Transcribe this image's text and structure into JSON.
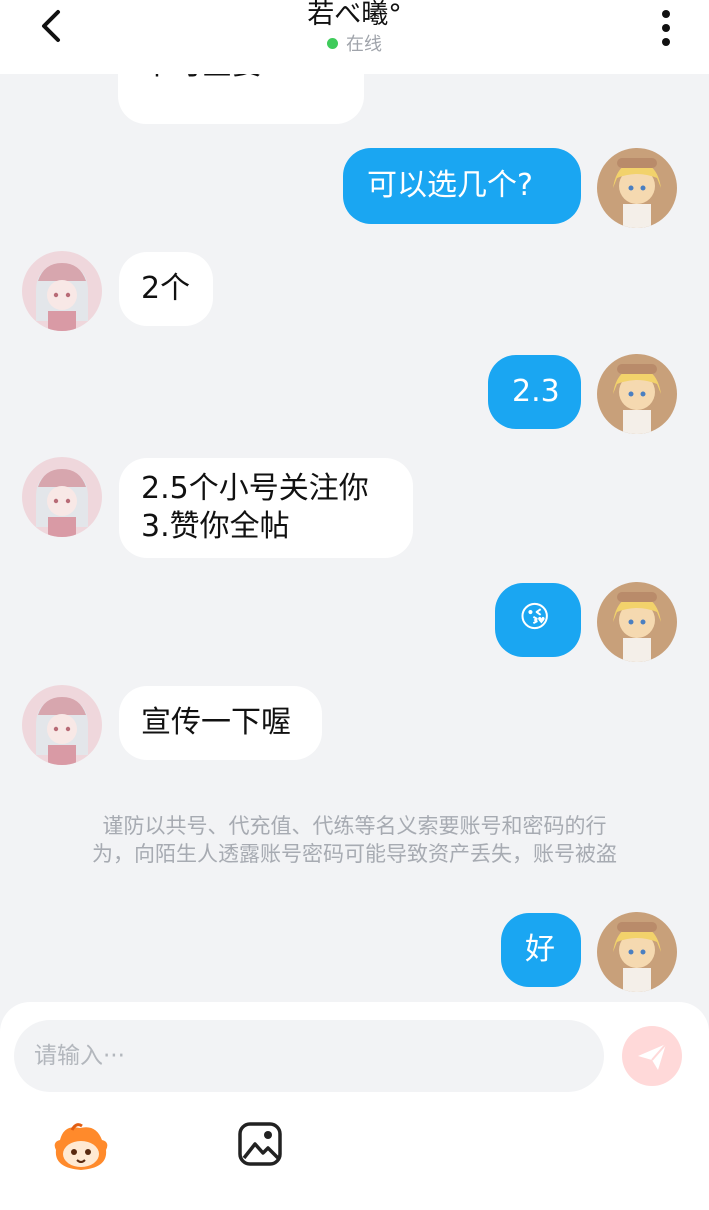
{
  "header": {
    "title": "若べ曦°",
    "status": "在线"
  },
  "messages": [
    {
      "side": "in",
      "text": "不可全要"
    },
    {
      "side": "out",
      "text": "可以选几个?"
    },
    {
      "side": "in",
      "text": "2个"
    },
    {
      "side": "out",
      "text": "2.3"
    },
    {
      "side": "in",
      "line1": "2.5个小号关注你",
      "line2": "3.赞你全帖"
    },
    {
      "side": "out",
      "text": "😘"
    },
    {
      "side": "in",
      "text": "宣传一下喔"
    },
    {
      "side": "out",
      "text": "好"
    }
  ],
  "notice": {
    "line1": "谨防以共号、代充值、代练等名义索要账号和密码的行",
    "line2": "为，向陌生人透露账号密码可能导致资产丢失，账号被盗"
  },
  "composer": {
    "placeholder": "请输入···"
  },
  "icons": {
    "back": "chevron-left-icon",
    "more": "more-vertical-icon",
    "send": "paper-plane-icon",
    "sticker": "mascot-sticker-icon",
    "image": "image-picker-icon"
  },
  "colors": {
    "outgoing_bubble": "#1aa6f2",
    "incoming_bubble": "#ffffff",
    "background": "#f2f3f5",
    "online_dot": "#3fcb5b",
    "send_button": "#ffd9d9"
  }
}
